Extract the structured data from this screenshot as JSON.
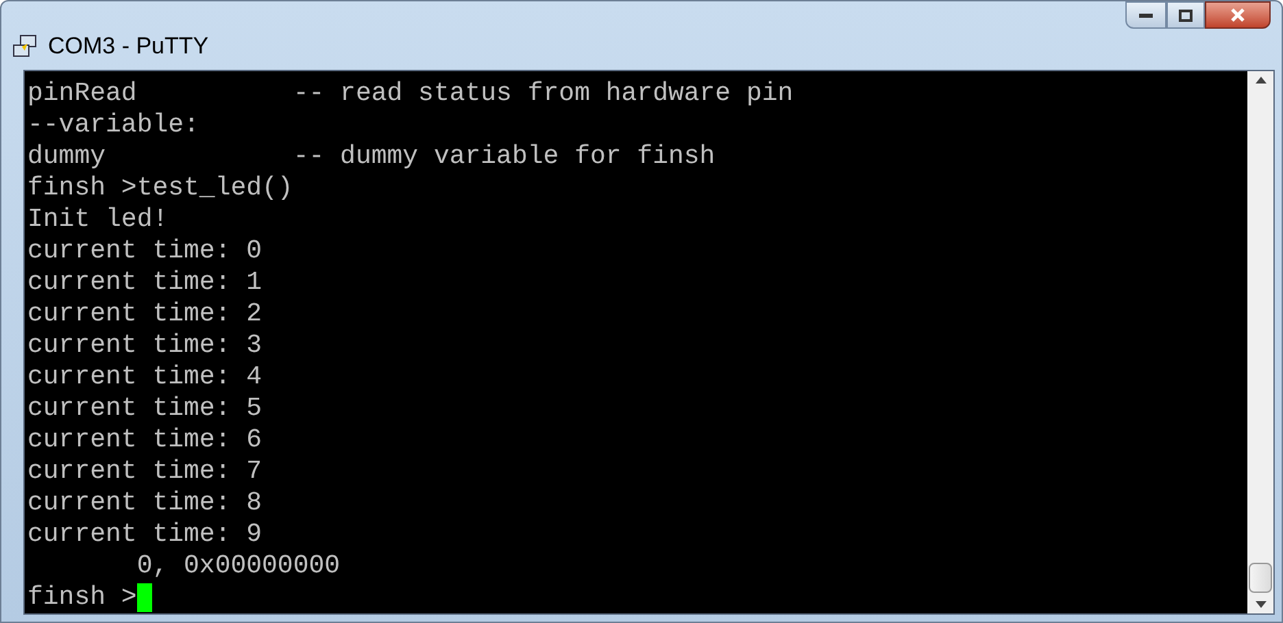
{
  "window": {
    "title": "COM3 - PuTTY"
  },
  "terminal": {
    "lines": [
      "pinRead          -- read status from hardware pin",
      "--variable:",
      "dummy            -- dummy variable for finsh",
      "finsh >test_led()",
      "Init led!",
      "current time: 0",
      "current time: 1",
      "current time: 2",
      "current time: 3",
      "current time: 4",
      "current time: 5",
      "current time: 6",
      "current time: 7",
      "current time: 8",
      "current time: 9",
      "       0, 0x00000000",
      "finsh >"
    ],
    "cursor": true
  }
}
